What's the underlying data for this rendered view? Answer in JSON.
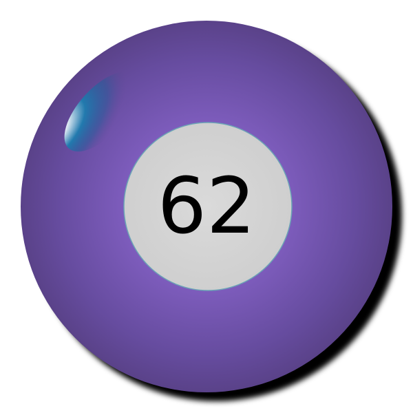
{
  "ball": {
    "number": "62",
    "colors": {
      "ball_body": "#5e4690",
      "ball_glow": "#8a66c6",
      "center_disc": "#d4d4d4",
      "center_disc_edge": "#6ba4b6",
      "highlight": "#1a73a3",
      "shadow": "#000000",
      "number_text": "#000000"
    }
  }
}
